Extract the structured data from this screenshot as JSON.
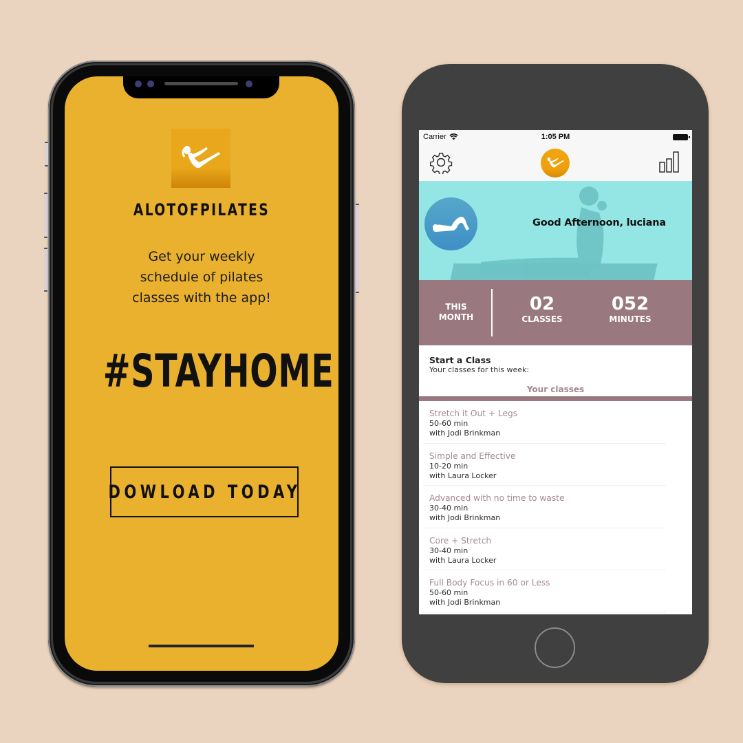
{
  "promo": {
    "brand_name": "ALOTOFPILATES",
    "logo_icon": "pilates-figure-icon",
    "tagline_lines": [
      "Get your weekly",
      "schedule of pilates",
      "classes with the app!"
    ],
    "hashtag": "#STAYHOME",
    "cta_label": "DOWLOAD TODAY",
    "screen_color": "#eab12f"
  },
  "app": {
    "status_bar": {
      "carrier": "Carrier",
      "wifi_icon": "wifi-icon",
      "time": "1:05 PM",
      "battery_icon": "battery-icon"
    },
    "nav": {
      "left_icon": "gear-icon",
      "center_icon": "app-logo-icon",
      "right_icon": "bar-chart-icon"
    },
    "hero": {
      "greeting": "Good Afternoon, luciana",
      "avatar_icon": "pilates-bridge-icon"
    },
    "stats": {
      "period_line1": "THIS",
      "period_line2": "MONTH",
      "classes_value": "02",
      "classes_label": "CLASSES",
      "minutes_value": "052",
      "minutes_label": "MINUTES"
    },
    "start_class": {
      "title": "Start a Class",
      "subtitle": "Your classes for this week:",
      "tab_label": "Your classes"
    },
    "classes": [
      {
        "name": "Stretch it Out + Legs",
        "duration": "50-60 min",
        "instructor": "with Jodi Brinkman"
      },
      {
        "name": "Simple and Effective",
        "duration": "10-20 min",
        "instructor": "with Laura Locker"
      },
      {
        "name": "Advanced with no time to waste",
        "duration": "30-40 min",
        "instructor": "with Jodi Brinkman"
      },
      {
        "name": "Core + Stretch",
        "duration": "30-40 min",
        "instructor": "with Laura Locker"
      },
      {
        "name": "Full Body Focus in 60 or Less",
        "duration": "50-60 min",
        "instructor": "with Jodi Brinkman"
      }
    ],
    "colors": {
      "accent_mauve": "#997880",
      "hero_teal": "#93e6e4",
      "logo_orange": "#f0a611"
    }
  }
}
